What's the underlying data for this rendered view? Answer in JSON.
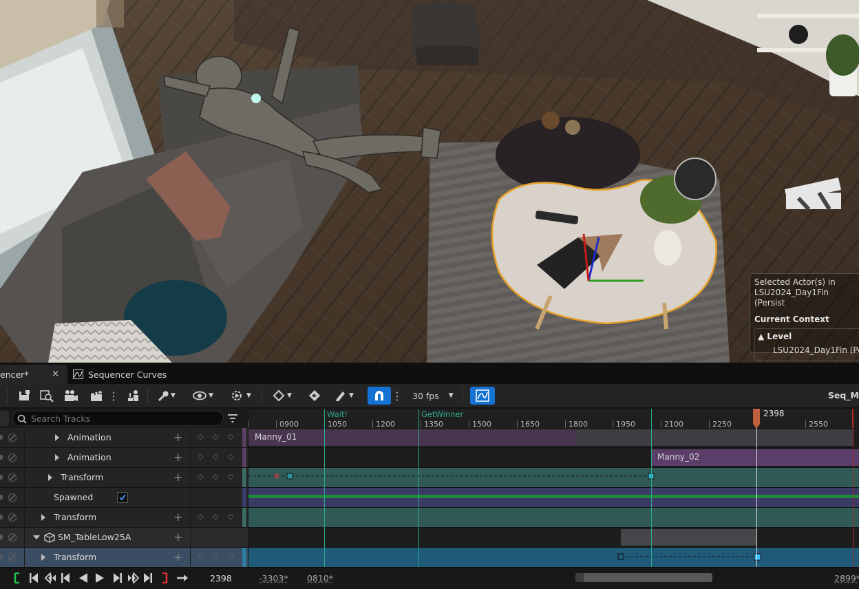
{
  "viewport": {
    "info": {
      "selected_line1": "Selected Actor(s) in",
      "selected_line2": "LSU2024_Day1Fin (Persist",
      "context_title": "Current Context",
      "level_label": "Level",
      "level_name": "LSU2024_Day1Fin (Pe"
    }
  },
  "tabs": [
    {
      "label": "encer*",
      "close": "×"
    },
    {
      "label": "Sequencer Curves"
    }
  ],
  "toolbar": {
    "fps": "30 fps",
    "sequence_name": "Seq_M"
  },
  "search": {
    "placeholder": "Search Tracks"
  },
  "ruler": {
    "ticks": [
      "0900",
      "1050",
      "1200",
      "1350",
      "1500",
      "1650",
      "1800",
      "1950",
      "2100",
      "2250",
      "2550"
    ],
    "markers": [
      "Wait!",
      "GetWinner"
    ],
    "playhead": "2398"
  },
  "tracks": [
    {
      "label": "Animation"
    },
    {
      "label": "Animation"
    },
    {
      "label": "Transform"
    },
    {
      "label": "Spawned",
      "checked": true
    },
    {
      "label": "Transform"
    },
    {
      "label": "SM_TableLow25A"
    },
    {
      "label": "Transform"
    }
  ],
  "sections": {
    "manny_01": "Manny_01",
    "manny_02": "Manny_02"
  },
  "transport": {
    "current_frame": "2398",
    "range_start": "-3303*",
    "view_start": "0810*",
    "range_end": "2899*"
  },
  "colors": {
    "accent": "#1472d2",
    "marker": "#2fa88d",
    "anim_section": "#4a3550",
    "transform_section": "#2f5a55",
    "selected_transform": "#1f5a78",
    "selection_outline": "#e8a12a"
  }
}
